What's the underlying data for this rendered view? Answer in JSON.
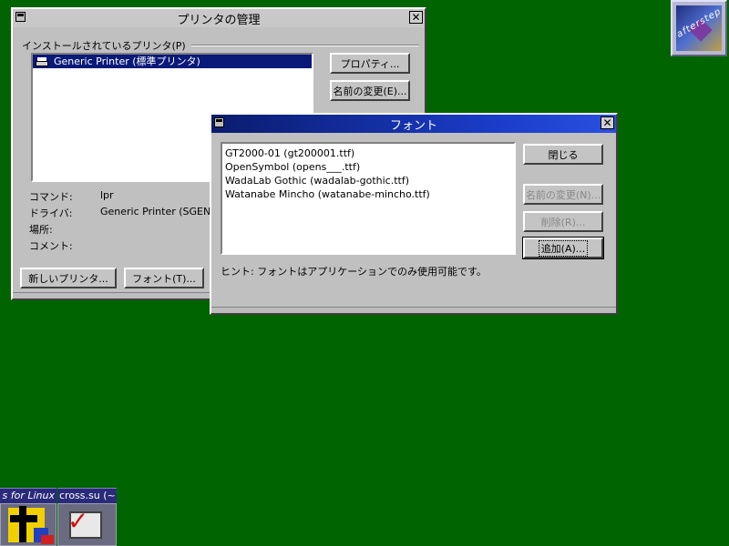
{
  "printer_window": {
    "title": "プリンタの管理",
    "group_label": "インストールされているプリンタ(P)",
    "printers": [
      {
        "name": "Generic Printer (標準プリンタ)",
        "selected": true,
        "icon": "printer-icon"
      }
    ],
    "buttons": {
      "properties": "プロパティ...",
      "rename": "名前の変更(E)...",
      "new_printer": "新しいプリンタ...",
      "fonts": "フォント(T)..."
    },
    "details": {
      "command_label": "コマンド:",
      "command_value": "lpr",
      "driver_label": "ドライバ:",
      "driver_value": "Generic Printer (SGENPRT",
      "location_label": "場所:",
      "location_value": "",
      "comment_label": "コメント:",
      "comment_value": ""
    }
  },
  "font_window": {
    "title": "フォント",
    "fonts": [
      "GT2000-01 (gt200001.ttf)",
      "OpenSymbol (opens___.ttf)",
      "WadaLab Gothic (wadalab-gothic.ttf)",
      "Watanabe Mincho (watanabe-mincho.ttf)"
    ],
    "buttons": {
      "close": "閉じる",
      "rename": "名前の変更(N)...",
      "delete": "削除(R)...",
      "add": "追加(A)..."
    },
    "hint": "ヒント: フォントはアプリケーションでのみ使用可能です。"
  },
  "desktop": {
    "background_color": "#006400",
    "logo_text": "afterstep",
    "taskbar_tabs": [
      "s for Linux",
      "cross.su (~)"
    ]
  }
}
